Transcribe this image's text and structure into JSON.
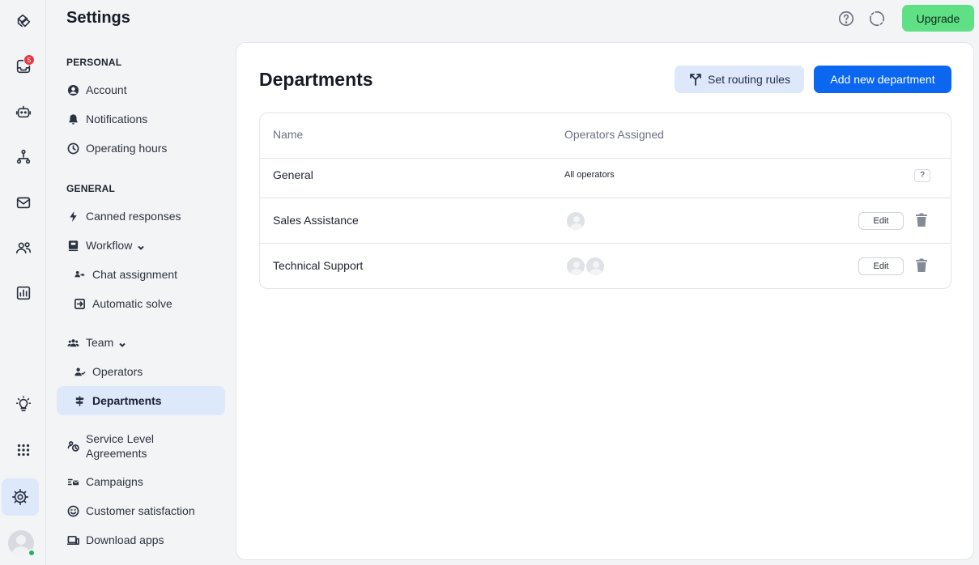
{
  "header": {
    "title": "Settings",
    "upgrade_label": "Upgrade"
  },
  "rail": {
    "inbox_badge": "5"
  },
  "sidebar": {
    "personal_title": "PERSONAL",
    "personal_items": [
      {
        "label": "Account",
        "icon": "account-icon"
      },
      {
        "label": "Notifications",
        "icon": "bell-icon"
      },
      {
        "label": "Operating hours",
        "icon": "clock-icon"
      }
    ],
    "general_title": "GENERAL",
    "general_items": {
      "canned": "Canned responses",
      "workflow": "Workflow",
      "chat_assignment": "Chat assignment",
      "automatic_solve": "Automatic solve",
      "team": "Team",
      "operators": "Operators",
      "departments": "Departments",
      "sla_line1": "Service Level",
      "sla_line2": "Agreements",
      "campaigns": "Campaigns",
      "customer_satisfaction": "Customer satisfaction",
      "download_apps": "Download apps"
    }
  },
  "main": {
    "title": "Departments",
    "routing_button": "Set routing rules",
    "add_button": "Add new department",
    "columns": [
      "Name",
      "Operators Assigned"
    ],
    "rows": [
      {
        "name": "General",
        "operators_text": "All operators",
        "help": "?"
      },
      {
        "name": "Sales Assistance",
        "operators_count": 1,
        "edit": "Edit"
      },
      {
        "name": "Technical Support",
        "operators_count": 2,
        "edit": "Edit"
      }
    ]
  },
  "colors": {
    "accent": "#0b66f0",
    "upgrade": "#5fe085",
    "active_bg": "#dde8fb",
    "badge": "#e23a45"
  }
}
